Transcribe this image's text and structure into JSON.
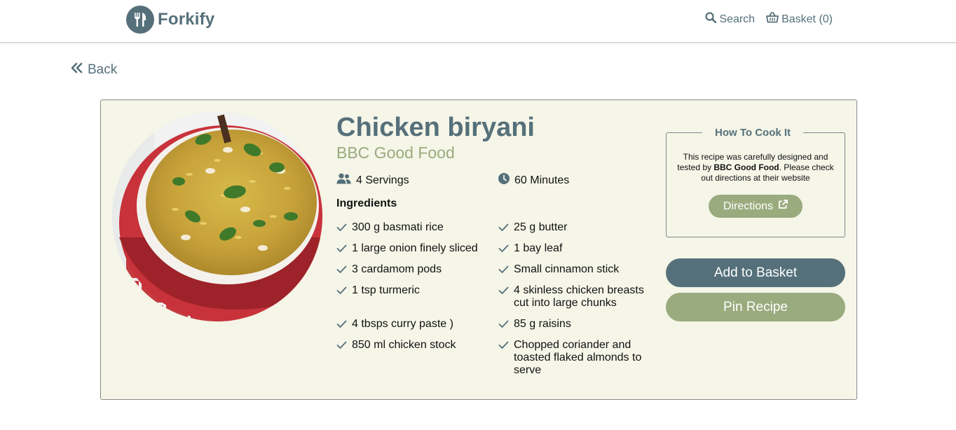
{
  "brand": {
    "name": "Forkify",
    "logo_icon": "fork-knife-icon"
  },
  "nav": {
    "search_label": "Search",
    "basket_label": "Basket (0)"
  },
  "back_label": "Back",
  "recipe": {
    "title": "Chicken biryani",
    "source": "BBC Good Food",
    "servings": "4 Servings",
    "time": "60 Minutes",
    "ingredients_heading": "Ingredients",
    "ingredients": [
      "300 g basmati rice",
      "25 g butter",
      "1 large onion finely sliced",
      "1 bay leaf",
      "3 cardamom pods",
      "Small cinnamon stick",
      "1 tsp turmeric",
      "4 skinless chicken breasts cut into large chunks",
      "4 tbsps curry paste )",
      "85 g raisins",
      "850 ml chicken stock",
      "Chopped coriander and toasted flaked almonds to serve"
    ]
  },
  "how_to": {
    "title": "How To Cook It",
    "text_before": "This recipe was carefully designed and tested by ",
    "publisher": "BBC Good Food",
    "text_after": ". Please check out directions at their website",
    "directions_label": "Directions"
  },
  "actions": {
    "add_to_basket": "Add to Basket",
    "pin_recipe": "Pin Recipe"
  },
  "colors": {
    "primary": "#55707a",
    "accent": "#9aab7e",
    "card_bg": "#f5f5e8"
  }
}
